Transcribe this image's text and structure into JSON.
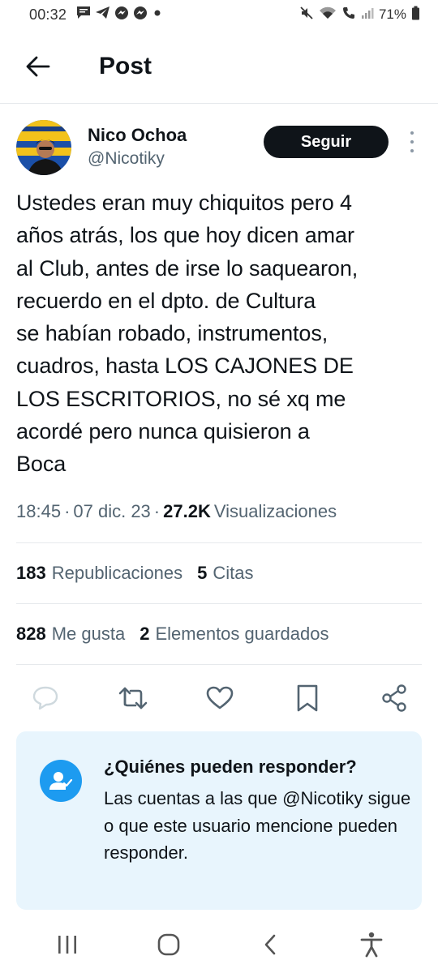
{
  "status_bar": {
    "time": "00:32",
    "battery": "71%",
    "left_icons": [
      "message-icon",
      "telegram-icon",
      "messenger-icon",
      "messenger-icon",
      "dot-icon"
    ],
    "right_icons": [
      "mute-icon",
      "wifi-icon",
      "call-icon",
      "signal-icon",
      "battery-icon"
    ]
  },
  "header": {
    "title": "Post"
  },
  "author": {
    "name": "Nico Ochoa",
    "handle": "@Nicotiky",
    "follow_label": "Seguir"
  },
  "post": {
    "text": "Ustedes eran muy chiquitos pero 4\naños atrás, los que hoy dicen amar\nal Club, antes de irse lo saquearon,\nrecuerdo en el dpto. de Cultura\nse habían robado, instrumentos,\ncuadros, hasta LOS CAJONES DE\nLOS ESCRITORIOS, no sé xq me\nacordé pero nunca quisieron a\nBoca",
    "time": "18:45",
    "separator": "·",
    "date": "07 dic. 23",
    "views_count": "27.2K",
    "views_label": "Visualizaciones"
  },
  "stats": {
    "reposts_count": "183",
    "reposts_label": "Republicaciones",
    "quotes_count": "5",
    "quotes_label": "Citas",
    "likes_count": "828",
    "likes_label": "Me gusta",
    "bookmarks_count": "2",
    "bookmarks_label": "Elementos guardados"
  },
  "actions": [
    "reply-icon",
    "repost-icon",
    "like-icon",
    "bookmark-icon",
    "share-icon"
  ],
  "reply_restriction": {
    "title": "¿Quiénes pueden responder?",
    "description": "Las cuentas a las que @Nicotiky sigue o que este usuario mencione pueden responder."
  },
  "nav_bar": [
    "recents-icon",
    "home-icon",
    "back-icon",
    "accessibility-icon"
  ],
  "colors": {
    "text": "#0f1419",
    "secondary": "#536471",
    "accent": "#1d9bf0",
    "card_bg": "#e8f5fd",
    "divider": "#e6e9ec"
  }
}
